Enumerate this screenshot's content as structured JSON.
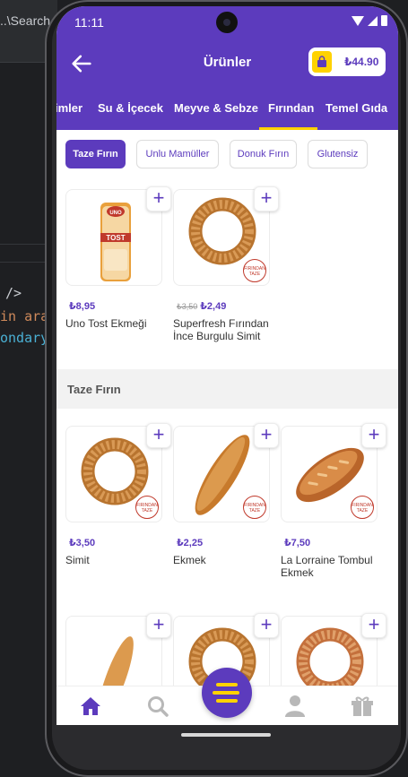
{
  "ide": {
    "top_text": "..\\Search",
    "code_lines": [
      "/>",
      "in ara",
      "ondary"
    ]
  },
  "status_bar": {
    "time": "11:11"
  },
  "app_bar": {
    "title": "Ürünler",
    "basket_total": "₺44.90"
  },
  "category_tabs": [
    {
      "label": "imler"
    },
    {
      "label": "Su & İçecek"
    },
    {
      "label": "Meyve & Sebze"
    },
    {
      "label": "Fırından",
      "active": true
    },
    {
      "label": "Temel Gıda"
    }
  ],
  "sub_tabs": [
    {
      "label": "Taze Fırın",
      "active": true
    },
    {
      "label": "Unlu Mamüller"
    },
    {
      "label": "Donuk Fırın"
    },
    {
      "label": "Glutensiz"
    }
  ],
  "featured_products": [
    {
      "name": "Uno Tost Ekmeği",
      "price": "₺8,95",
      "old_price": "",
      "image": "toast-bread",
      "pack_brand": "UNO",
      "pack_label": "TOST"
    },
    {
      "name": "Superfresh Fırından İnce Burgulu Simit",
      "price": "₺2,49",
      "old_price": "₺3,50",
      "image": "simit"
    }
  ],
  "section": {
    "title": "Taze Fırın"
  },
  "section_products": [
    {
      "name": "Simit",
      "price": "₺3,50",
      "image": "simit"
    },
    {
      "name": "Ekmek",
      "price": "₺2,25",
      "image": "baguette"
    },
    {
      "name": "La Lorraine Tombul Ekmek",
      "price": "₺7,50",
      "image": "bread-loaf"
    }
  ],
  "more_products": [
    {
      "image": "baguette"
    },
    {
      "image": "simit"
    },
    {
      "image": "simit"
    }
  ],
  "badge": {
    "text_line1": "FIRINDAN",
    "text_line2": "TAZE"
  },
  "bottom_nav": [
    "home-icon",
    "search-icon",
    "menu-icon",
    "profile-icon",
    "gift-icon"
  ],
  "colors": {
    "primary": "#5c3bbd",
    "accent": "#ffd200"
  }
}
